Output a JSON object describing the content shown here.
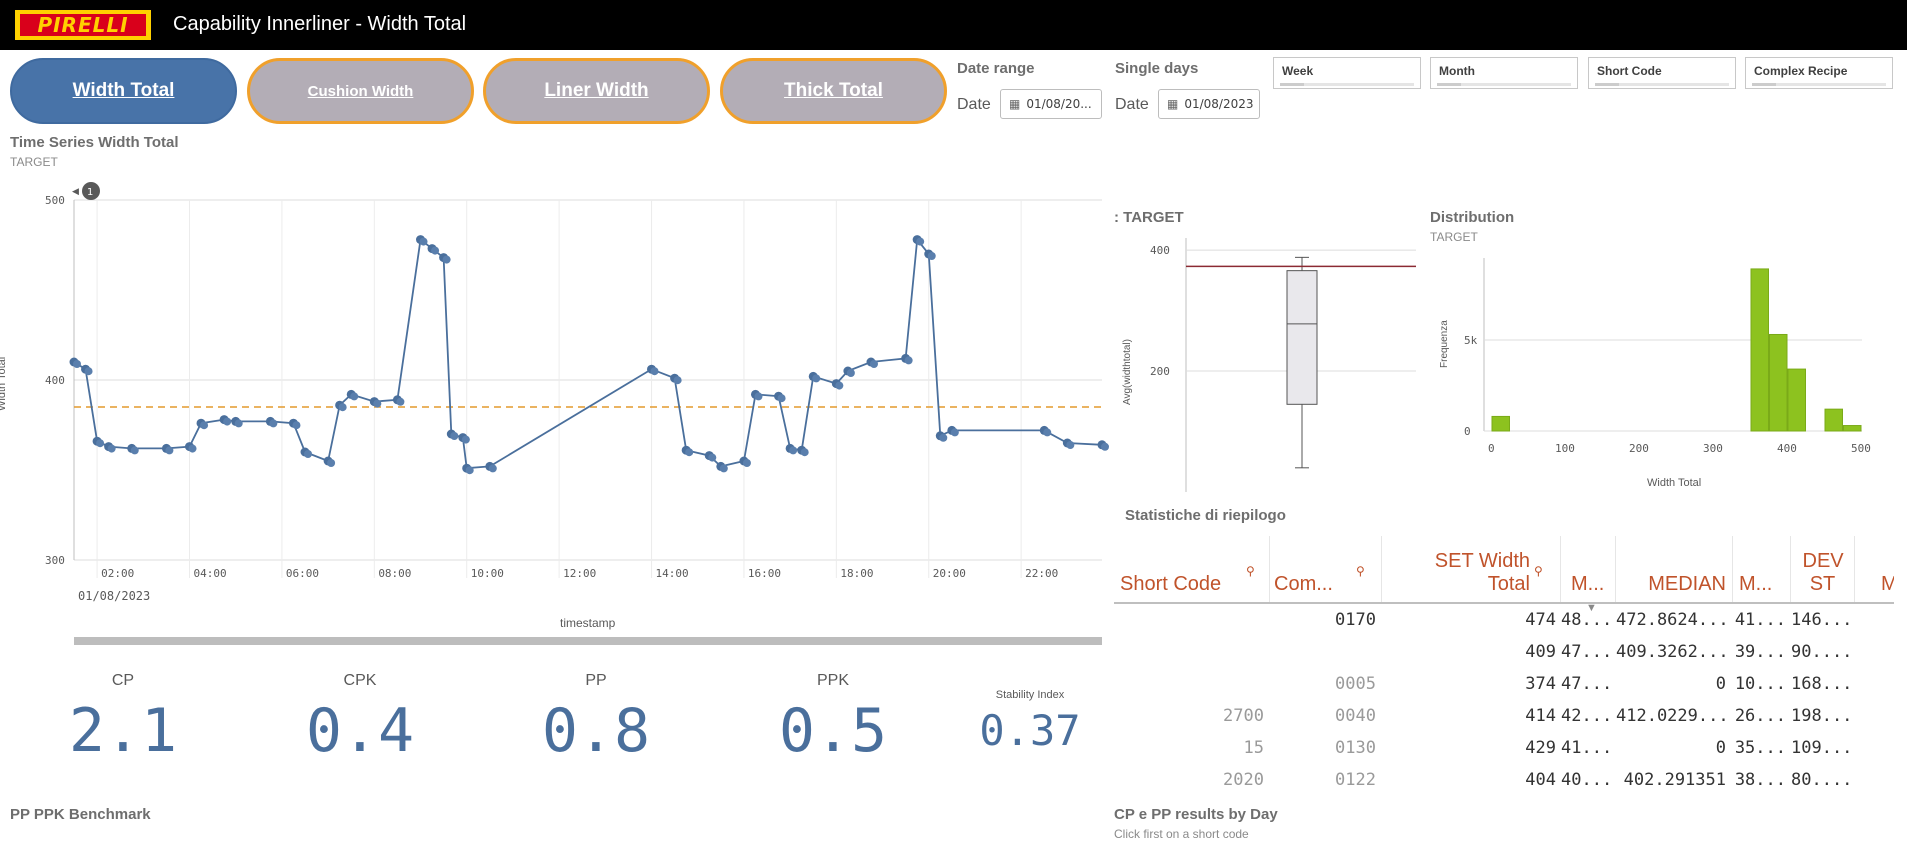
{
  "app": {
    "logo_text": "PIRELLI",
    "title": "Capability Innerliner - Width Total"
  },
  "nav": [
    {
      "label": "Width Total"
    },
    {
      "label": "Cushion Width"
    },
    {
      "label": "Liner Width"
    },
    {
      "label": "Thick Total"
    }
  ],
  "date_range": {
    "title": "Date range",
    "label": "Date",
    "value": "01/08/20..."
  },
  "single_days": {
    "title": "Single days",
    "label": "Date",
    "value": "01/08/2023"
  },
  "filters": [
    "Week",
    "Month",
    "Short Code",
    "Complex Recipe"
  ],
  "timeseries": {
    "title": "Time Series Width Total",
    "subtitle": "TARGET",
    "badge": "1",
    "ylabel": "Width Total",
    "xlabel": "timestamp",
    "date_label": "01/08/2023"
  },
  "boxplot": {
    "title": ": TARGET",
    "ylabel": "Avg(widthtotal)"
  },
  "distribution": {
    "title": "Distribution",
    "subtitle": "TARGET",
    "ylabel": "Frequenza",
    "xlabel": "Width Total"
  },
  "kpis": [
    {
      "label": "CP",
      "value": "2.1"
    },
    {
      "label": "CPK",
      "value": "0.4"
    },
    {
      "label": "PP",
      "value": "0.8"
    },
    {
      "label": "PPK",
      "value": "0.5"
    }
  ],
  "stability": {
    "label": "Stability Index",
    "value": "0.37"
  },
  "summary": {
    "title": "Statistiche di riepilogo",
    "columns": [
      "Short Code",
      "Com...",
      "SET Width Total",
      "M...",
      "MEDIAN",
      "M...",
      "DEV ST",
      "M"
    ],
    "rows": [
      [
        "",
        "0170",
        "474",
        "48...",
        "472.8624...",
        "41...",
        "146..."
      ],
      [
        "",
        "",
        "409",
        "47...",
        "409.3262...",
        "39...",
        "90...."
      ],
      [
        "",
        "0005",
        "374",
        "47...",
        "0",
        "10...",
        "168..."
      ],
      [
        "2700",
        "0040",
        "414",
        "42...",
        "412.0229...",
        "26...",
        "198..."
      ],
      [
        "15",
        "0130",
        "429",
        "41...",
        "0",
        "35...",
        "109..."
      ],
      [
        "2020",
        "0122",
        "404",
        "40...",
        "402.291351",
        "38...",
        "80...."
      ]
    ]
  },
  "benchmark": {
    "title": "PP PPK Benchmark"
  },
  "byday": {
    "title": "CP e PP results by Day",
    "subtitle": "Click first on a short code"
  },
  "chart_data": [
    {
      "type": "scatter",
      "title": "Time Series Width Total",
      "subtitle": "TARGET",
      "xlabel": "timestamp",
      "ylabel": "Width Total",
      "ylim": [
        300,
        500
      ],
      "xlim": [
        "01:30",
        "23:45"
      ],
      "x_ticks": [
        "02:00",
        "04:00",
        "06:00",
        "08:00",
        "10:00",
        "12:00",
        "14:00",
        "16:00",
        "18:00",
        "20:00",
        "22:00"
      ],
      "y_ticks": [
        300,
        400,
        500
      ],
      "target_line": 385,
      "series": [
        {
          "points": [
            [
              "01:30",
              410
            ],
            [
              "01:45",
              406
            ],
            [
              "02:00",
              366
            ],
            [
              "02:15",
              363
            ],
            [
              "02:45",
              362
            ],
            [
              "03:30",
              362
            ],
            [
              "04:00",
              363
            ],
            [
              "04:15",
              376
            ],
            [
              "04:45",
              378
            ],
            [
              "05:00",
              377
            ],
            [
              "05:45",
              377
            ],
            [
              "06:15",
              376
            ],
            [
              "06:30",
              360
            ],
            [
              "07:00",
              355
            ],
            [
              "07:15",
              386
            ],
            [
              "07:30",
              392
            ],
            [
              "08:00",
              388
            ],
            [
              "08:30",
              389
            ],
            [
              "09:00",
              478
            ],
            [
              "09:15",
              473
            ],
            [
              "09:30",
              468
            ],
            [
              "09:40",
              370
            ],
            [
              "09:55",
              368
            ],
            [
              "10:00",
              351
            ],
            [
              "10:30",
              352
            ],
            [
              "14:00",
              406
            ],
            [
              "14:30",
              401
            ],
            [
              "14:45",
              361
            ],
            [
              "15:15",
              358
            ],
            [
              "15:30",
              352
            ],
            [
              "16:00",
              355
            ],
            [
              "16:15",
              392
            ],
            [
              "16:45",
              391
            ],
            [
              "17:00",
              362
            ],
            [
              "17:15",
              361
            ],
            [
              "17:30",
              402
            ],
            [
              "18:00",
              398
            ],
            [
              "18:15",
              405
            ],
            [
              "18:45",
              410
            ],
            [
              "19:30",
              412
            ],
            [
              "19:45",
              478
            ],
            [
              "20:00",
              470
            ],
            [
              "20:15",
              369
            ],
            [
              "20:30",
              372
            ],
            [
              "22:30",
              372
            ],
            [
              "23:00",
              365
            ],
            [
              "23:45",
              364
            ]
          ]
        }
      ]
    },
    {
      "type": "box",
      "title": ": TARGET",
      "ylabel": "Avg(widthtotal)",
      "y_ticks": [
        200,
        400
      ],
      "target_line": 373,
      "min": 40,
      "q1": 145,
      "median": 278,
      "q3": 366,
      "max": 388
    },
    {
      "type": "bar",
      "title": "Distribution",
      "subtitle": "TARGET",
      "xlabel": "Width Total",
      "ylabel": "Frequenza",
      "x_ticks": [
        0,
        100,
        200,
        300,
        400,
        500
      ],
      "y_ticks": [
        "0",
        "5k"
      ],
      "bins": [
        {
          "x0": 0,
          "x1": 25,
          "value": 800
        },
        {
          "x0": 350,
          "x1": 375,
          "value": 8900
        },
        {
          "x0": 375,
          "x1": 400,
          "value": 5300
        },
        {
          "x0": 400,
          "x1": 425,
          "value": 3400
        },
        {
          "x0": 450,
          "x1": 475,
          "value": 1200
        },
        {
          "x0": 475,
          "x1": 500,
          "value": 300
        }
      ]
    }
  ]
}
